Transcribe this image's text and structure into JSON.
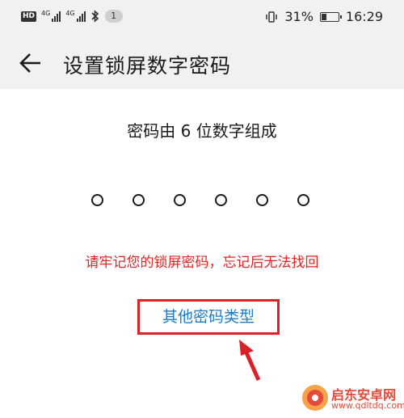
{
  "status_bar": {
    "signal_label_1": "4G",
    "signal_label_2": "4G",
    "notification_count": "1",
    "battery_percent": "31%",
    "battery_level": 0.31,
    "time": "16:29"
  },
  "header": {
    "title": "设置锁屏数字密码",
    "back_icon": "arrow-left-icon"
  },
  "main": {
    "subtitle": "密码由 6 位数字组成",
    "pin_length": 6,
    "warning": "请牢记您的锁屏密码，忘记后无法找回",
    "other_type_link": "其他密码类型"
  },
  "colors": {
    "warning": "#e02424",
    "link": "#1f7bc2",
    "annotation": "#d8222a"
  },
  "watermark": {
    "name": "启东安卓网",
    "url": "www.qdltdq.com"
  }
}
